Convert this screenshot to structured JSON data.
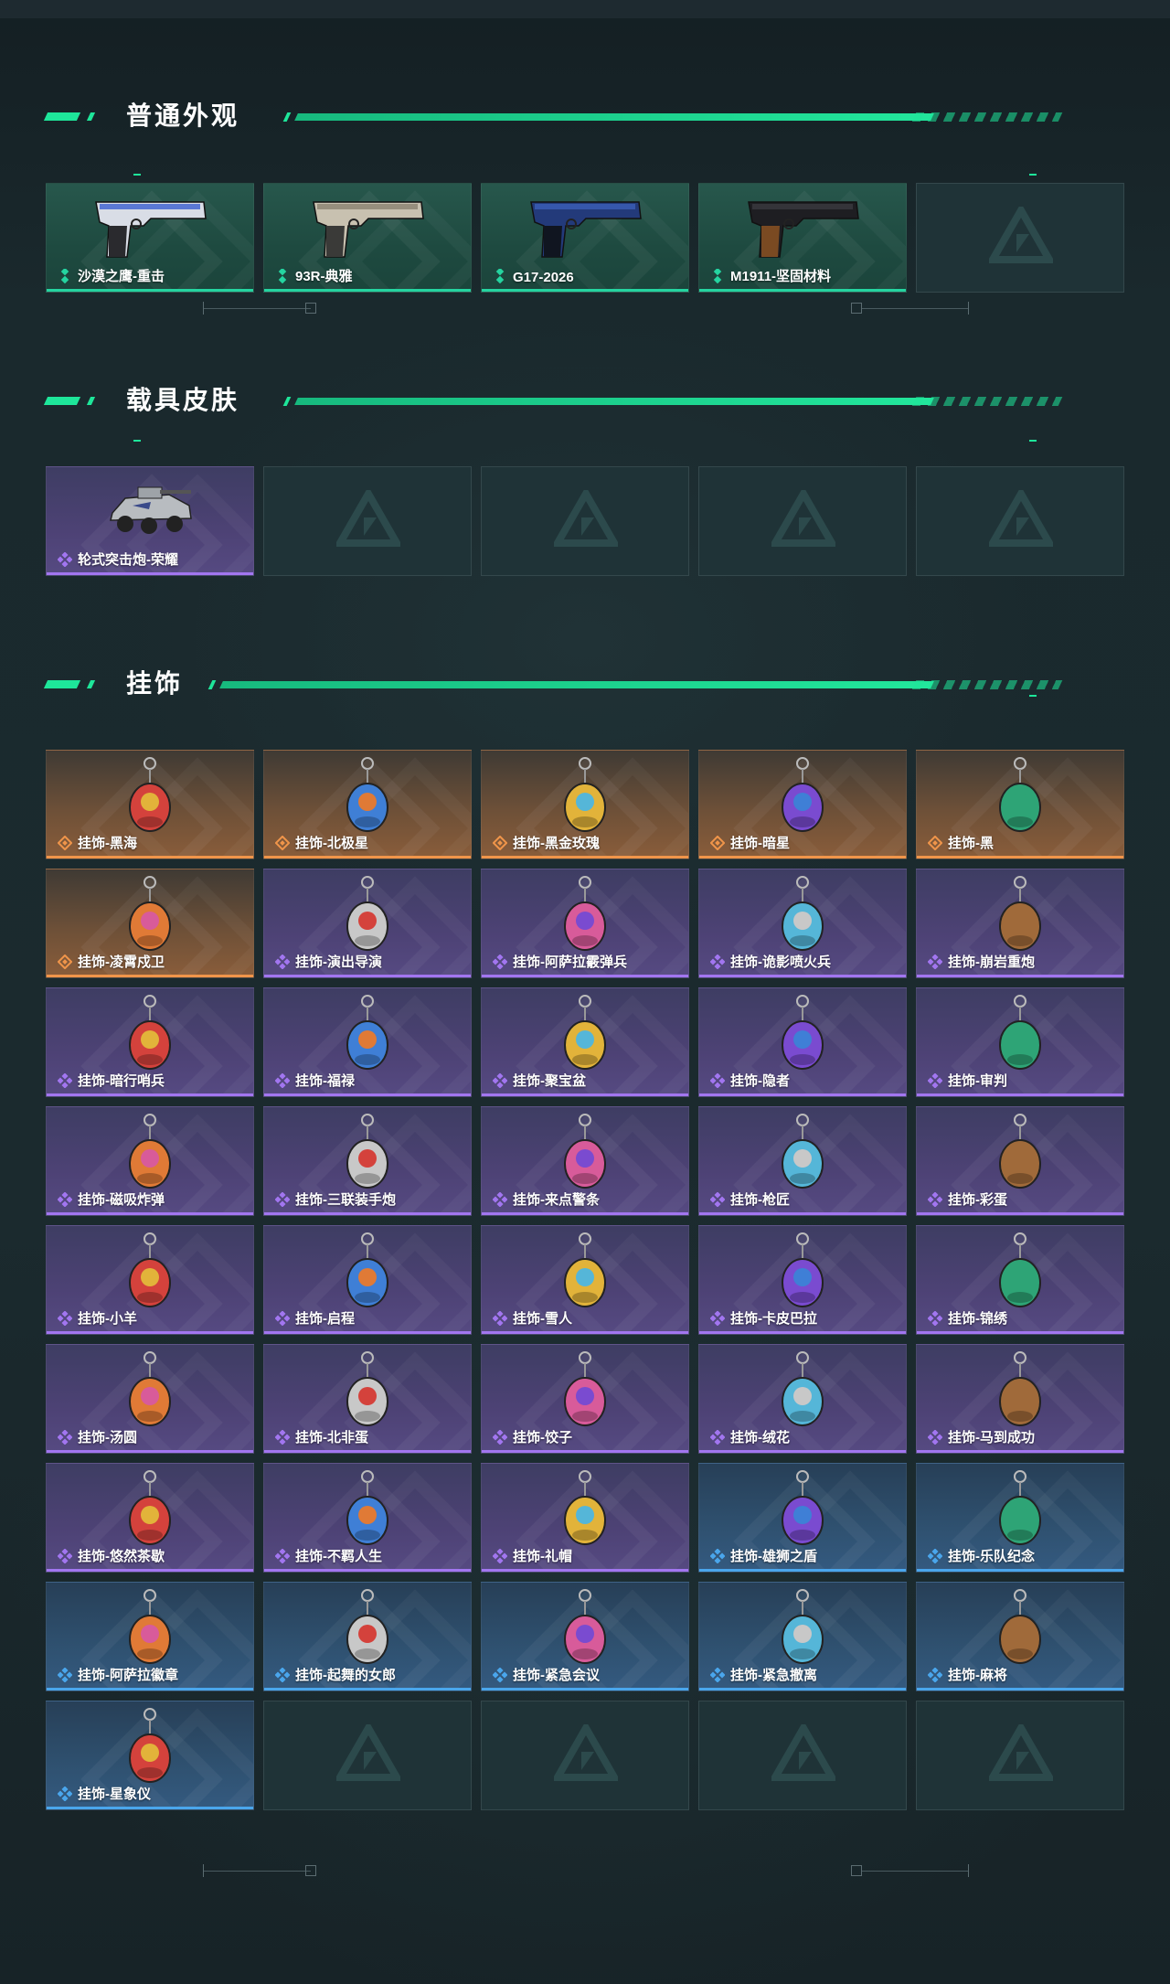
{
  "sections": {
    "weapon": {
      "title": "普通外观",
      "items": [
        {
          "name": "沙漠之鹰-重击",
          "rarity": "green",
          "icon": "pistol-icon"
        },
        {
          "name": "93R-典雅",
          "rarity": "green",
          "icon": "pistol-icon"
        },
        {
          "name": "G17-2026",
          "rarity": "green",
          "icon": "pistol-icon"
        },
        {
          "name": "M1911-坚固材料",
          "rarity": "green",
          "icon": "pistol-icon"
        }
      ]
    },
    "vehicle": {
      "title": "载具皮肤",
      "items": [
        {
          "name": "轮式突击炮-荣耀",
          "rarity": "purple",
          "icon": "armored-vehicle-icon"
        }
      ]
    },
    "charm": {
      "title": "挂饰",
      "items": [
        {
          "name": "挂饰-黑海",
          "rarity": "orange"
        },
        {
          "name": "挂饰-北极星",
          "rarity": "orange"
        },
        {
          "name": "挂饰-黑金玫瑰",
          "rarity": "orange"
        },
        {
          "name": "挂饰-暗星",
          "rarity": "orange"
        },
        {
          "name": "挂饰-黑",
          "rarity": "orange"
        },
        {
          "name": "挂饰-凌霄戍卫",
          "rarity": "orange"
        },
        {
          "name": "挂饰-演出导演",
          "rarity": "purple"
        },
        {
          "name": "挂饰-阿萨拉霰弹兵",
          "rarity": "purple"
        },
        {
          "name": "挂饰-诡影喷火兵",
          "rarity": "purple"
        },
        {
          "name": "挂饰-崩岩重炮",
          "rarity": "purple"
        },
        {
          "name": "挂饰-暗行哨兵",
          "rarity": "purple"
        },
        {
          "name": "挂饰-福禄",
          "rarity": "purple"
        },
        {
          "name": "挂饰-聚宝盆",
          "rarity": "purple"
        },
        {
          "name": "挂饰-隐者",
          "rarity": "purple"
        },
        {
          "name": "挂饰-审判",
          "rarity": "purple"
        },
        {
          "name": "挂饰-磁吸炸弹",
          "rarity": "purple"
        },
        {
          "name": "挂饰-三联装手炮",
          "rarity": "purple"
        },
        {
          "name": "挂饰-来点警条",
          "rarity": "purple"
        },
        {
          "name": "挂饰-枪匠",
          "rarity": "purple"
        },
        {
          "name": "挂饰-彩蛋",
          "rarity": "purple"
        },
        {
          "name": "挂饰-小羊",
          "rarity": "purple"
        },
        {
          "name": "挂饰-启程",
          "rarity": "purple"
        },
        {
          "name": "挂饰-雪人",
          "rarity": "purple"
        },
        {
          "name": "挂饰-卡皮巴拉",
          "rarity": "purple"
        },
        {
          "name": "挂饰-锦绣",
          "rarity": "purple"
        },
        {
          "name": "挂饰-汤圆",
          "rarity": "purple"
        },
        {
          "name": "挂饰-北非蛋",
          "rarity": "purple"
        },
        {
          "name": "挂饰-饺子",
          "rarity": "purple"
        },
        {
          "name": "挂饰-绒花",
          "rarity": "purple"
        },
        {
          "name": "挂饰-马到成功",
          "rarity": "purple"
        },
        {
          "name": "挂饰-悠然茶歇",
          "rarity": "purple"
        },
        {
          "name": "挂饰-不羁人生",
          "rarity": "purple"
        },
        {
          "name": "挂饰-礼帽",
          "rarity": "purple"
        },
        {
          "name": "挂饰-雄狮之盾",
          "rarity": "blue"
        },
        {
          "name": "挂饰-乐队纪念",
          "rarity": "blue"
        },
        {
          "name": "挂饰-阿萨拉徽章",
          "rarity": "blue"
        },
        {
          "name": "挂饰-起舞的女郎",
          "rarity": "blue"
        },
        {
          "name": "挂饰-紧急会议",
          "rarity": "blue"
        },
        {
          "name": "挂饰-紧急撤离",
          "rarity": "blue"
        },
        {
          "name": "挂饰-麻将",
          "rarity": "blue"
        },
        {
          "name": "挂饰-星象仪",
          "rarity": "blue"
        }
      ]
    }
  },
  "colors": {
    "accent": "#1ee69a",
    "rarity_green": "#25d4a0",
    "rarity_purple": "#a276f0",
    "rarity_orange": "#f0954a",
    "rarity_blue": "#4aa6ec"
  }
}
